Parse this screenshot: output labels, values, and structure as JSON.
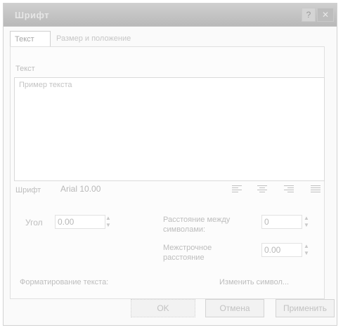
{
  "window": {
    "title": "Шрифт"
  },
  "titlebar": {
    "help": "?",
    "close": "✕"
  },
  "tabs": [
    {
      "label": "Текст"
    },
    {
      "label": "Размер и положение"
    }
  ],
  "text_section": {
    "label": "Текст",
    "value": "Пример текста"
  },
  "font": {
    "label": "Шрифт",
    "value": "Arial 10.00"
  },
  "alignment_icons": [
    "align-left-icon",
    "align-center-icon",
    "align-right-icon",
    "align-justify-icon"
  ],
  "angle": {
    "label": "Угол",
    "value": "0.00"
  },
  "char_spacing": {
    "label": "Расстояние между символами:",
    "value": "0"
  },
  "line_spacing": {
    "label": "Межстрочное расстояние",
    "value": "0.00"
  },
  "format_text": {
    "label": "Форматирование текста:"
  },
  "change_button": {
    "label": "Изменить символ..."
  },
  "buttons": {
    "ok": "OK",
    "cancel": "Отмена",
    "apply": "Применить"
  }
}
